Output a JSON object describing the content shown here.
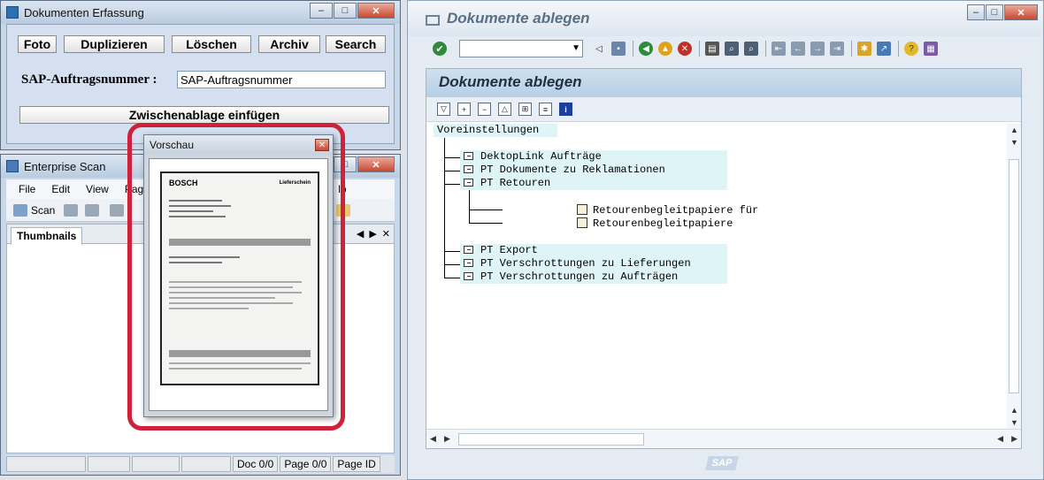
{
  "erfassung": {
    "title": "Dokumenten Erfassung",
    "buttons": [
      "Foto",
      "Duplizieren",
      "Löschen",
      "Archiv",
      "Search"
    ],
    "auftrag_label": "SAP-Auftragsnummer :",
    "auftrag_value": "SAP-Auftragsnummer",
    "paste_button": "Zwischenablage einfügen"
  },
  "scan": {
    "title": "Enterprise Scan",
    "menu": [
      "File",
      "Edit",
      "View",
      "Pag",
      "lp"
    ],
    "scan_button": "Scan",
    "tab": "Thumbnails",
    "status": {
      "doc": "Doc 0/0",
      "page": "Page 0/0",
      "pageid": "Page ID"
    }
  },
  "vorschau": {
    "title": "Vorschau",
    "doc_logo": "BOSCH",
    "doc_heading": "Lieferschein"
  },
  "sap": {
    "window_title": "Dokumente ablegen",
    "panel_title": "Dokumente ablegen",
    "tree": {
      "root": "Voreinstellungen",
      "nodes": [
        "DektopLink Aufträge",
        "PT Dokumente zu Reklamationen",
        "PT Retouren",
        "PT Export",
        "PT Verschrottungen zu Lieferungen",
        "PT Verschrottungen zu Aufträgen"
      ],
      "retouren_children": [
        "Retourenbegleitpapiere für",
        "Retourenbegleitpapiere"
      ]
    },
    "logo": "SAP"
  },
  "colors": {
    "highlight_ring": "#d0203a",
    "tree_node_bg": "#dff4f6",
    "sap_header": "#b7cfe5"
  }
}
